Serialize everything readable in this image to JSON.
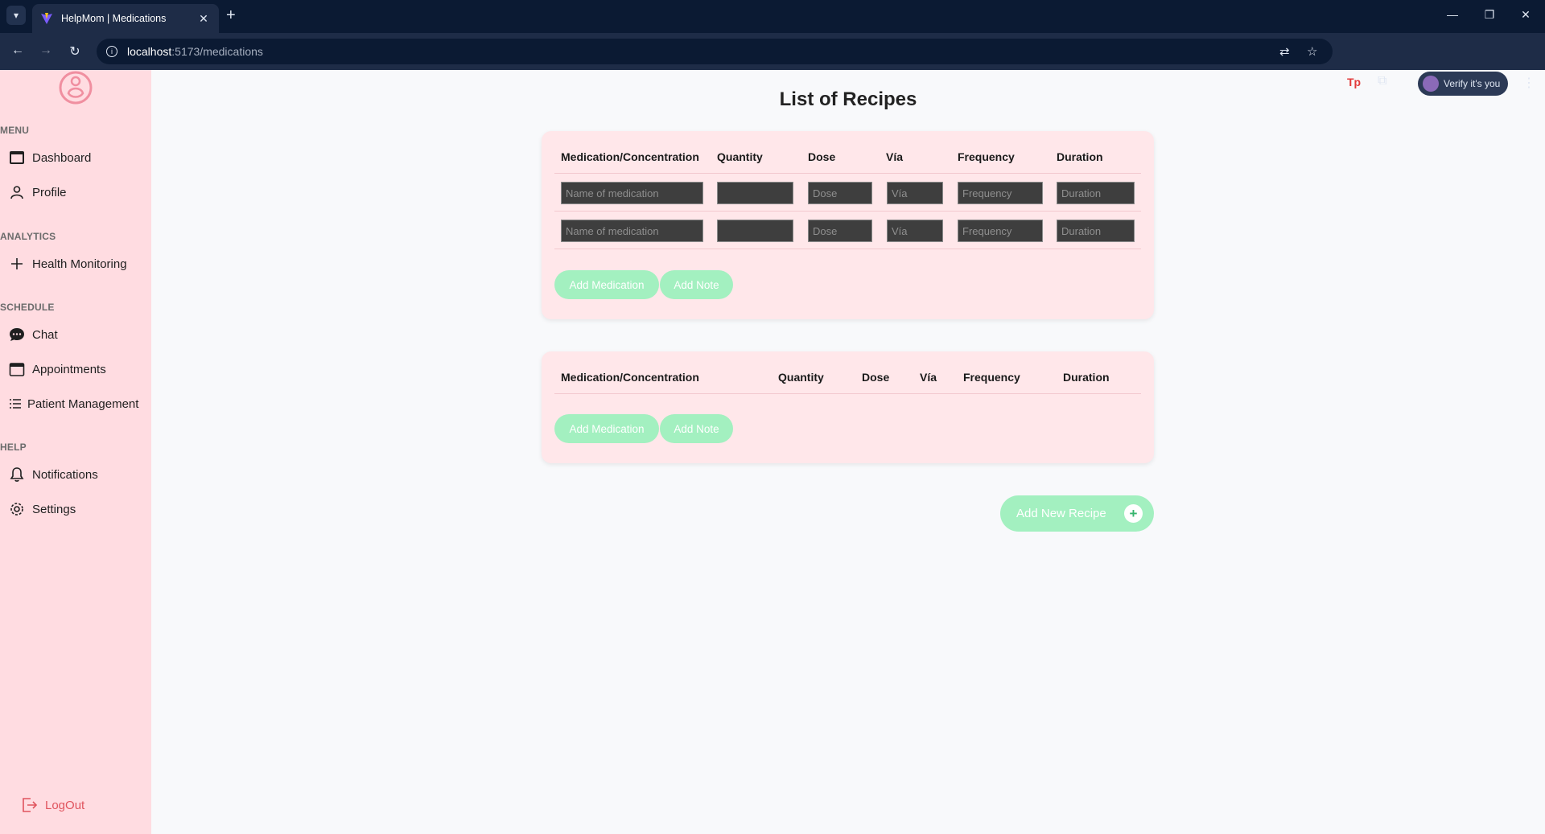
{
  "browser": {
    "tab_title": "HelpMom | Medications",
    "url_host": "localhost",
    "url_path": ":5173/medications",
    "profile_label": "Verify it's you",
    "ext_label": "Tp"
  },
  "sidebar": {
    "sections": {
      "menu": "MENU",
      "analytics": "ANALYTICS",
      "schedule": "SCHEDULE",
      "help": "HELP"
    },
    "items": {
      "dashboard": "Dashboard",
      "profile": "Profile",
      "health_monitoring": "Health Monitoring",
      "chat": "Chat",
      "appointments": "Appointments",
      "patient_management": "Patient Management",
      "notifications": "Notifications",
      "settings": "Settings"
    },
    "logout": "LogOut"
  },
  "main": {
    "title": "List of Recipes",
    "columns": [
      "Medication/Concentration",
      "Quantity",
      "Dose",
      "Vía",
      "Frequency",
      "Duration"
    ],
    "placeholders": {
      "medication": "Name of medication",
      "quantity": "",
      "dose": "Dose",
      "via": "Vía",
      "frequency": "Frequency",
      "duration": "Duration"
    },
    "add_medication": "Add Medication",
    "add_note": "Add Note",
    "add_new_recipe": "Add New Recipe",
    "colors": {
      "sidebar_bg": "#ffdce1",
      "card_bg": "#ffe7ea",
      "button_green": "#a3f0c0",
      "logout_red": "#e0545e"
    }
  }
}
